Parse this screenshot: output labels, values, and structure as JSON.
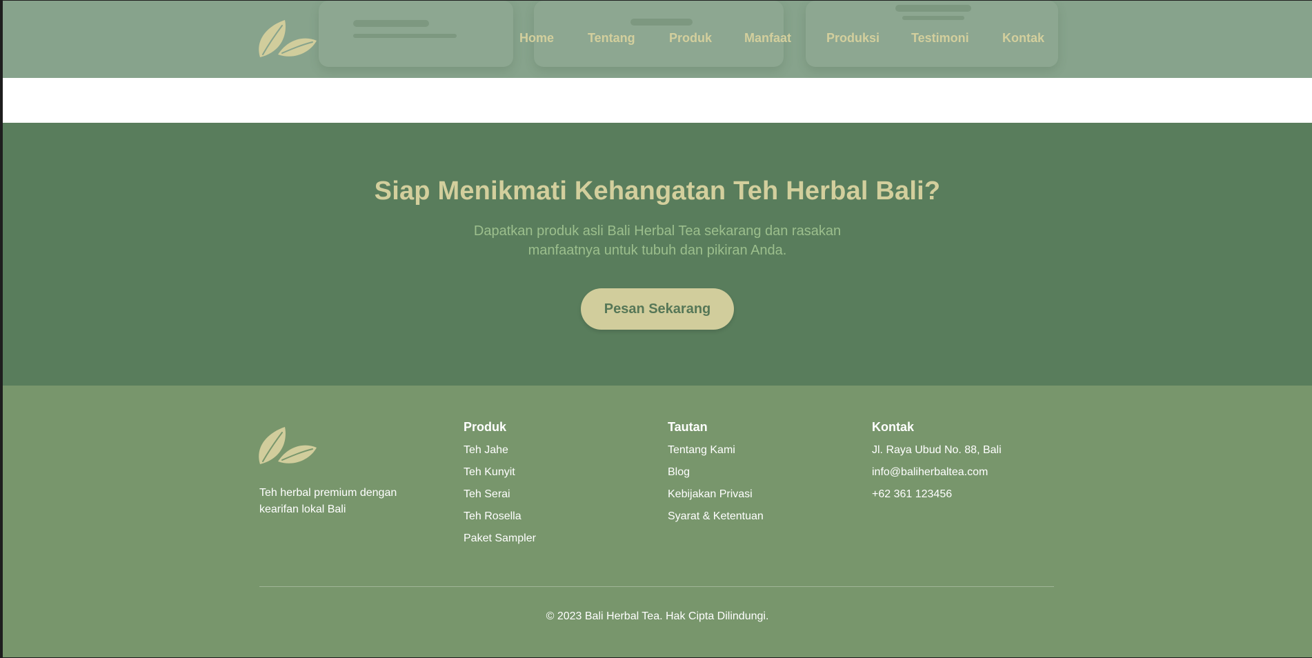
{
  "header": {
    "nav": [
      {
        "label": "Home"
      },
      {
        "label": "Tentang"
      },
      {
        "label": "Produk"
      },
      {
        "label": "Manfaat"
      },
      {
        "label": "Produksi"
      },
      {
        "label": "Testimoni"
      },
      {
        "label": "Kontak"
      }
    ]
  },
  "cta": {
    "title": "Siap Menikmati Kehangatan Teh Herbal Bali?",
    "subtitle": "Dapatkan produk asli Bali Herbal Tea sekarang dan rasakan manfaatnya untuk tubuh dan pikiran Anda.",
    "button_label": "Pesan Sekarang"
  },
  "footer": {
    "tagline": "Teh herbal premium dengan kearifan lokal Bali",
    "columns": [
      {
        "title": "Produk",
        "items": [
          "Teh Jahe",
          "Teh Kunyit",
          "Teh Serai",
          "Teh Rosella",
          "Paket Sampler"
        ]
      },
      {
        "title": "Tautan",
        "items": [
          "Tentang Kami",
          "Blog",
          "Kebijakan Privasi",
          "Syarat & Ketentuan"
        ]
      },
      {
        "title": "Kontak",
        "items": [
          "Jl. Raya Ubud No. 88, Bali",
          "info@baliherbaltea.com",
          "+62 361 123456"
        ]
      }
    ],
    "copyright": "© 2023 Bali Herbal Tea. Hak Cipta Dilindungi."
  },
  "colors": {
    "header_bg": "#87a38c",
    "cta_bg": "#597d5c",
    "footer_bg": "#78966c",
    "accent": "#d3cf9d",
    "cta_subtitle": "#9cbf8d",
    "button_text": "#567757"
  },
  "icons": {
    "logo": "tea-leaves-logo-icon"
  }
}
